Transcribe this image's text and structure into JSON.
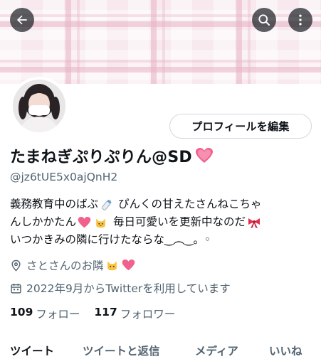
{
  "header": {
    "back_icon": "arrow-left-icon",
    "search_icon": "search-icon",
    "more_icon": "more-vertical-icon"
  },
  "profile": {
    "edit_button_label": "プロフィールを編集",
    "display_name": "たまねぎぷりぷりん@SD",
    "handle": "@jz6tUE5x0ajQnH2",
    "bio": {
      "line1": "義務教育中のばぶ",
      "line1b": "ぴんくの甘えたさんねこちゃ",
      "line2": "んしかかたん",
      "line2b": "毎日可愛いを更新中なのだ",
      "line3": "いつかきみの隣に行けたならな‿︵‿。◦"
    },
    "location": "さとさんのお隣",
    "joined": "2022年9月からTwitterを利用しています",
    "following_count": "109",
    "following_label": "フォロー",
    "followers_count": "117",
    "followers_label": "フォロワー"
  },
  "tabs": [
    {
      "label": "ツイート",
      "active": true
    },
    {
      "label": "ツイートと返信",
      "active": false
    },
    {
      "label": "メディア",
      "active": false
    },
    {
      "label": "いいね",
      "active": false
    }
  ],
  "colors": {
    "primary_text": "#0f1419",
    "secondary_text": "#536471",
    "border": "#cfd9de",
    "banner_pink": "#f7e9ee"
  }
}
